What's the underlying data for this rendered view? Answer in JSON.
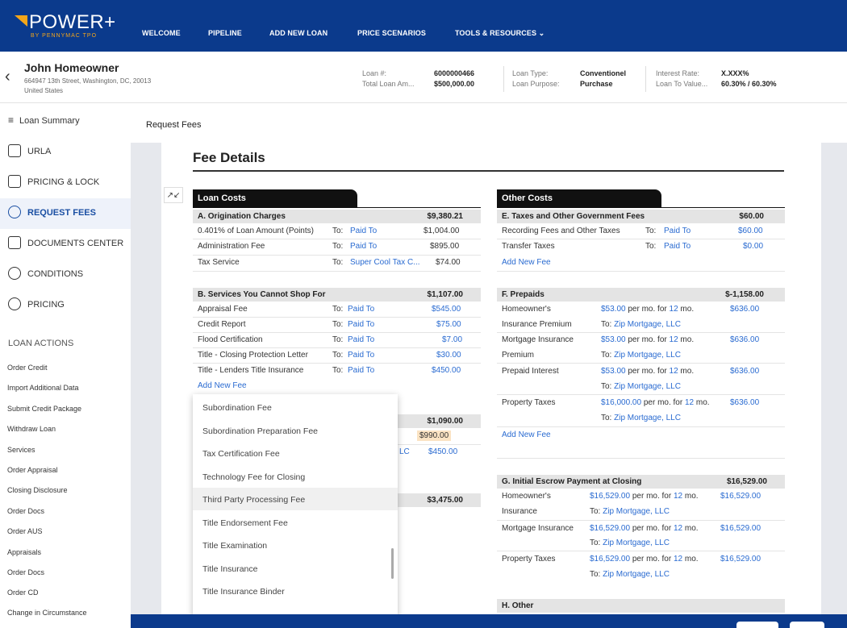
{
  "brand": {
    "name": "POWER+",
    "sub": "BY PENNYMAC TPO",
    "accent": "#f4a61a",
    "bar": "#0b3a8c"
  },
  "nav": [
    "WELCOME",
    "PIPELINE",
    "ADD NEW LOAN",
    "PRICE SCENARIOS",
    "TOOLS & RESOURCES"
  ],
  "nav_tools_icon": "chevron-down-icon",
  "borrower": {
    "name": "John Homeowner",
    "address1": "664947 13th Street, Washington, DC, 20013",
    "address2": "United States"
  },
  "loan": {
    "loan_no_label": "Loan #:",
    "loan_no": "6000000466",
    "total_label": "Total Loan Am...",
    "total": "$500,000.00",
    "type_label": "Loan Type:",
    "type": "Conventionel",
    "purpose_label": "Loan Purpose:",
    "purpose": "Purchase",
    "rate_label": "Interest Rate:",
    "rate": "X.XXX%",
    "ltv_label": "Loan To Value...",
    "ltv": "60.30% / 60.30%"
  },
  "sidebar": {
    "items": [
      "Loan Summary",
      "URLA",
      "PRICING & LOCK",
      "REQUEST FEES",
      "DOCUMENTS CENTER",
      "CONDITIONS",
      "PRICING"
    ],
    "active": "REQUEST FEES",
    "loan_actions_title": "LOAN ACTIONS",
    "loan_actions": [
      "Order Credit",
      "Import Additional Data",
      "Submit Credit Package",
      "Withdraw Loan",
      "Services",
      "Order Appraisal",
      "Closing Disclosure",
      "Order Docs",
      "Order AUS",
      "Appraisals",
      "Order Docs",
      "Order CD",
      "Change in Circumstance"
    ]
  },
  "breadcrumb": "Request Fees",
  "page_title": "Fee Details",
  "loan_costs": {
    "tab": "Loan Costs",
    "a": {
      "title": "A. Origination Charges",
      "total": "$9,380.21",
      "rows": [
        {
          "name": "0.401% of Loan Amount (Points)",
          "to": "To:",
          "payee": "Paid To",
          "amount": "$1,004.00"
        },
        {
          "name": "Administration Fee",
          "to": "To:",
          "payee": "Paid To",
          "amount": "$895.00"
        },
        {
          "name": "Tax Service",
          "to": "To:",
          "payee": "Super Cool Tax C...",
          "amount": "$74.00"
        }
      ]
    },
    "b": {
      "title": "B. Services You Cannot Shop For",
      "total": "$1,107.00",
      "rows": [
        {
          "name": "Appraisal Fee",
          "to": "To:",
          "payee": "Paid To",
          "amount": "$545.00"
        },
        {
          "name": "Credit Report",
          "to": "To:",
          "payee": "Paid To",
          "amount": "$75.00"
        },
        {
          "name": "Flood Certification",
          "to": "To:",
          "payee": "Paid To",
          "amount": "$7.00"
        },
        {
          "name": "Title - Closing Protection Letter",
          "to": "To:",
          "payee": "Paid To",
          "amount": "$30.00"
        },
        {
          "name": "Title - Lenders Title Insurance",
          "to": "To:",
          "payee": "Paid To",
          "amount": "$450.00"
        }
      ],
      "add": "Add New Fee"
    },
    "c_total": "$1,090.00",
    "c_amount_hl": "$990.00",
    "c_payee_tail": "LC",
    "c_amount": "$450.00",
    "d_total": "$3,475.00"
  },
  "dropdown": {
    "items": [
      "Subordination Fee",
      "Subordination Preparation Fee",
      "Tax Certification Fee",
      "Technology Fee for Closing",
      "Third Party Processing Fee",
      "Title Endorsement Fee",
      "Title Examination",
      "Title Insurance",
      "Title Insurance Binder"
    ],
    "highlighted": "Third Party Processing Fee"
  },
  "other_costs": {
    "tab": "Other Costs",
    "e": {
      "title": "E. Taxes and Other Government Fees",
      "total": "$60.00",
      "rows": [
        {
          "name": "Recording Fees and Other Taxes",
          "to": "To:",
          "payee": "Paid To",
          "amount": "$60.00"
        },
        {
          "name": "Transfer Taxes",
          "to": "To:",
          "payee": "Paid To",
          "amount": "$0.00"
        }
      ],
      "add": "Add New Fee"
    },
    "f": {
      "title": "F. Prepaids",
      "total": "$-1,158.00",
      "rows": [
        {
          "name": "Homeowner's",
          "name2": "Insurance Premium",
          "rate": "$53.00",
          "per": "per mo. for",
          "months": "12",
          "mo": "mo.",
          "to": "To:",
          "payee": "Zip Mortgage, LLC",
          "amount": "$636.00"
        },
        {
          "name": "Mortgage Insurance",
          "name2": "Premium",
          "rate": "$53.00",
          "per": "per mo. for",
          "months": "12",
          "mo": "mo.",
          "to": "To:",
          "payee": "Zip Mortgage, LLC",
          "amount": "$636.00"
        },
        {
          "name": "Prepaid Interest",
          "name2": "",
          "rate": "$53.00",
          "per": "per mo. for",
          "months": "12",
          "mo": "mo.",
          "to": "To:",
          "payee": "Zip Mortgage, LLC",
          "amount": "$636.00"
        },
        {
          "name": "Property Taxes",
          "name2": "",
          "rate": "$16,000.00",
          "per": "per mo. for",
          "months": "12",
          "mo": "mo.",
          "to": "To:",
          "payee": "Zip Mortgage, LLC",
          "amount": "$636.00"
        }
      ],
      "add": "Add New Fee"
    },
    "g": {
      "title": "G. Initial Escrow Payment at Closing",
      "total": "$16,529.00",
      "rows": [
        {
          "name": "Homeowner's",
          "name2": "Insurance",
          "rate": "$16,529.00",
          "per": "per mo. for",
          "months": "12",
          "mo": "mo.",
          "to": "To:",
          "payee": "Zip Mortgage, LLC",
          "amount": "$16,529.00"
        },
        {
          "name": "Mortgage Insurance",
          "name2": "",
          "rate": "$16,529.00",
          "per": "per mo. for",
          "months": "12",
          "mo": "mo.",
          "to": "To:",
          "payee": "Zip Mortgage, LLC",
          "amount": "$16,529.00"
        },
        {
          "name": "Property Taxes",
          "name2": "",
          "rate": "$16,529.00",
          "per": "per mo. for",
          "months": "12",
          "mo": "mo.",
          "to": "To:",
          "payee": "Zip Mortgage, LLC",
          "amount": "$16,529.00"
        }
      ]
    },
    "h": {
      "title": "H. Other"
    }
  }
}
